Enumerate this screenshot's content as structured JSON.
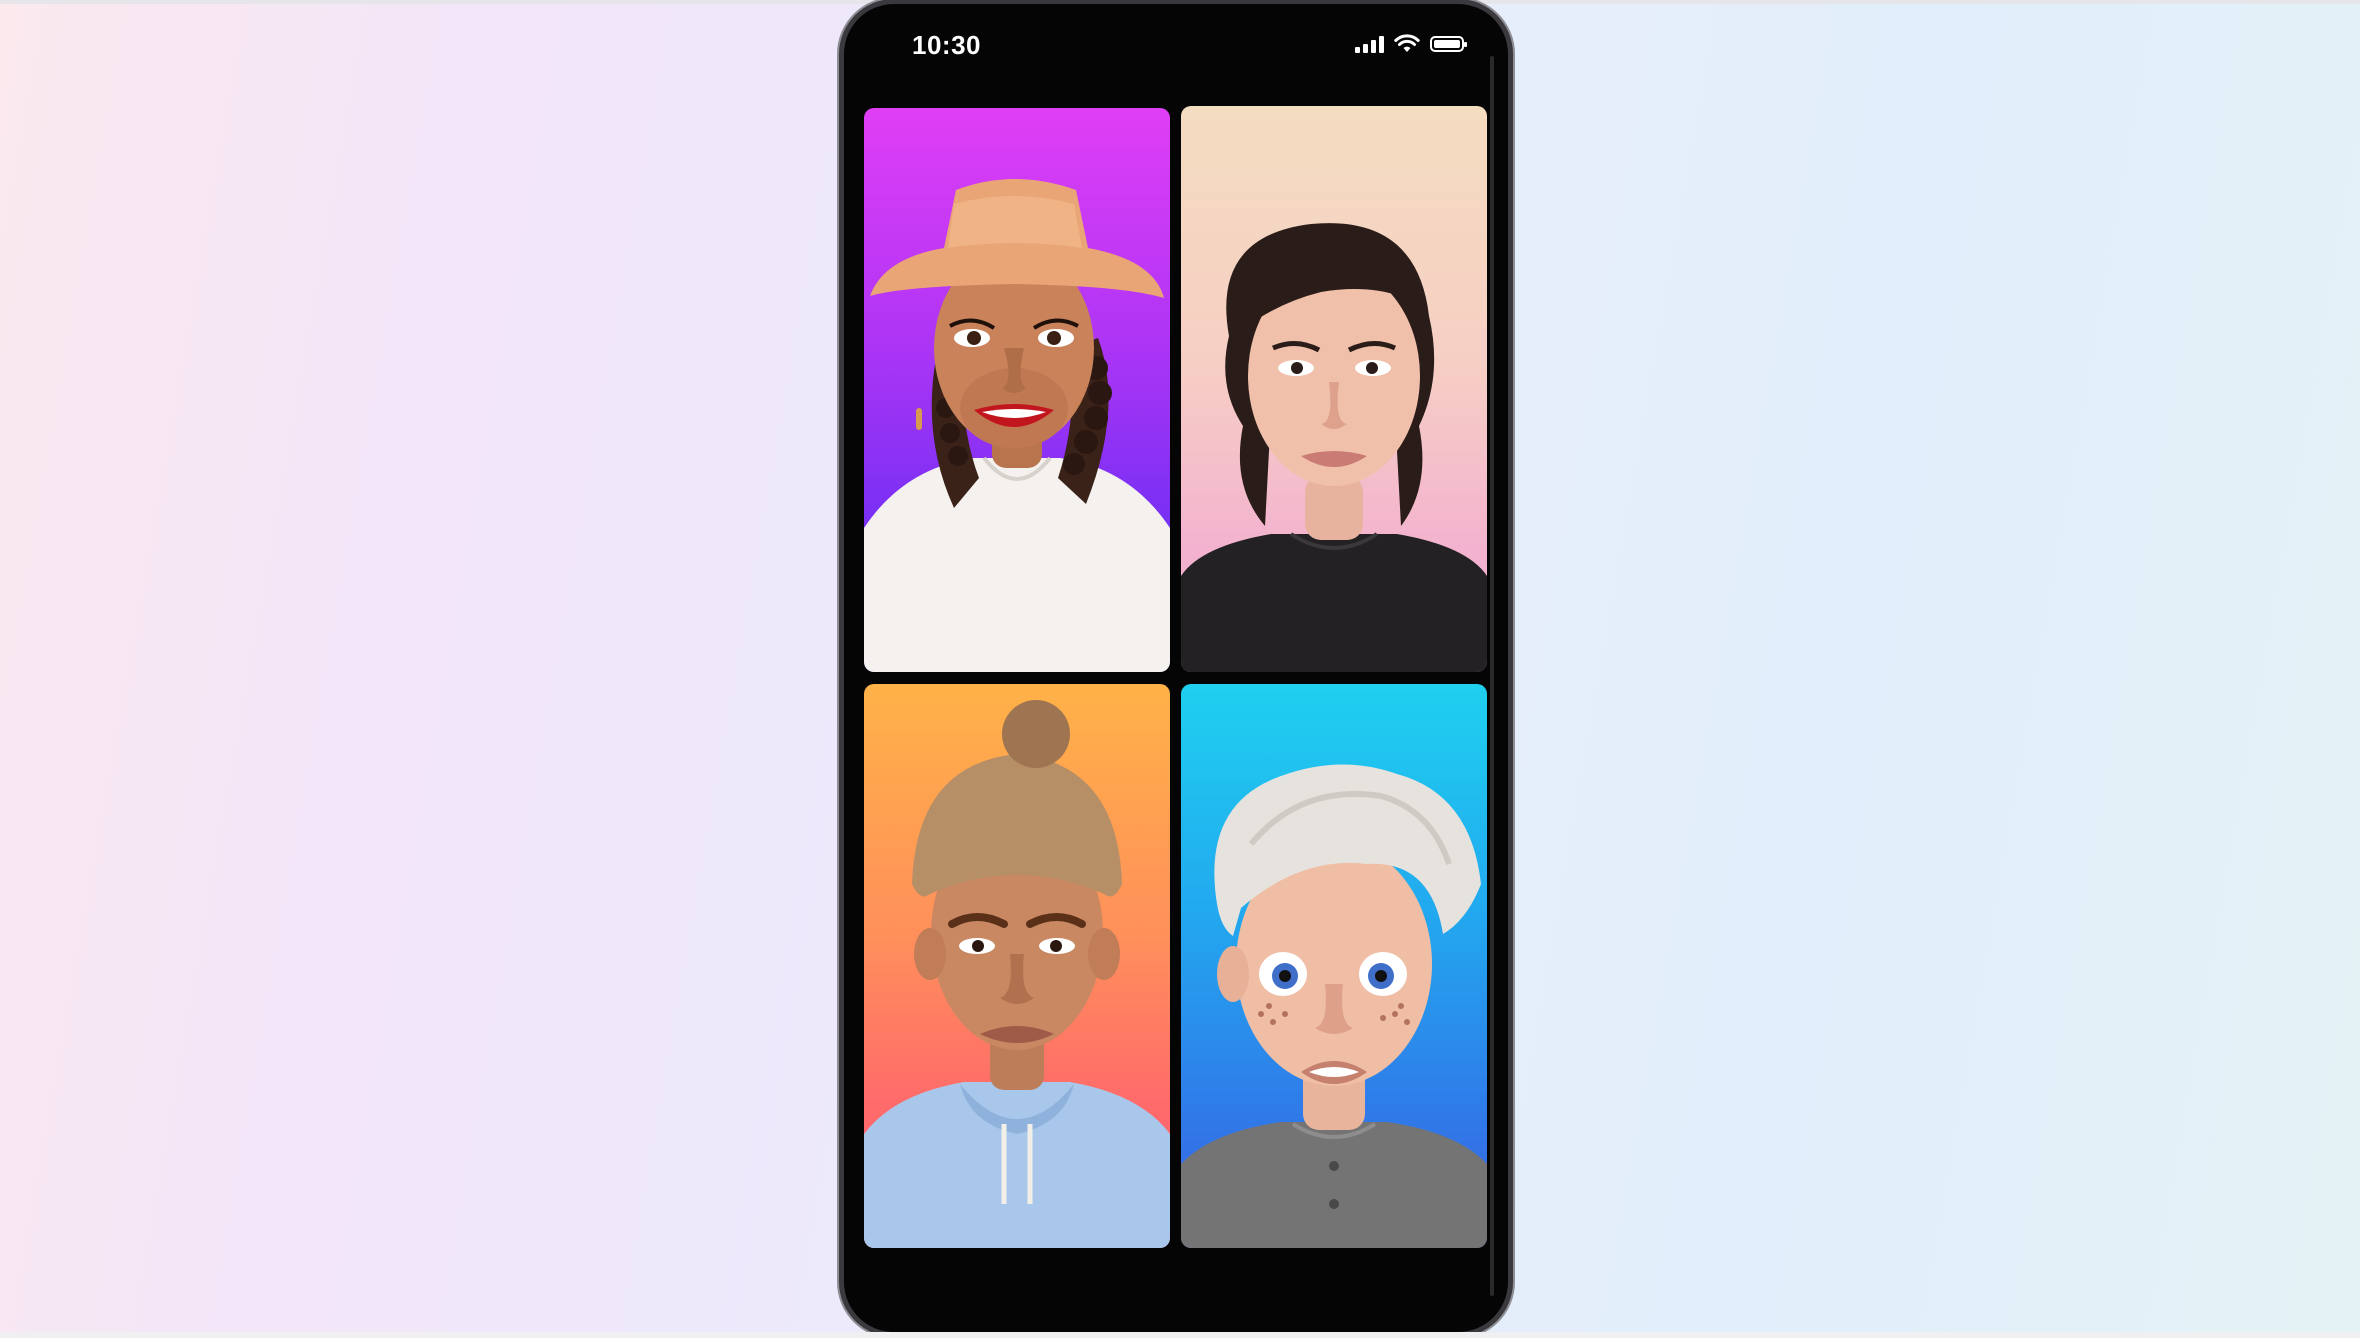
{
  "status_bar": {
    "time": "10:30",
    "icons": [
      "cellular-signal-icon",
      "wifi-icon",
      "battery-icon"
    ]
  },
  "call_grid": {
    "participants": [
      {
        "avatar": "avatar-bucket-hat-locs",
        "background_colors": [
          "#e03ef5",
          "#5a28d8"
        ]
      },
      {
        "avatar": "avatar-dark-hair-black-tee",
        "background_colors": [
          "#f4dcc0",
          "#eea6c8"
        ]
      },
      {
        "avatar": "avatar-beanie-hoodie",
        "background_colors": [
          "#ffb247",
          "#ff5d80"
        ]
      },
      {
        "avatar": "avatar-white-hair-freckles",
        "background_colors": [
          "#1fd0ef",
          "#3a5fe0"
        ]
      }
    ]
  }
}
